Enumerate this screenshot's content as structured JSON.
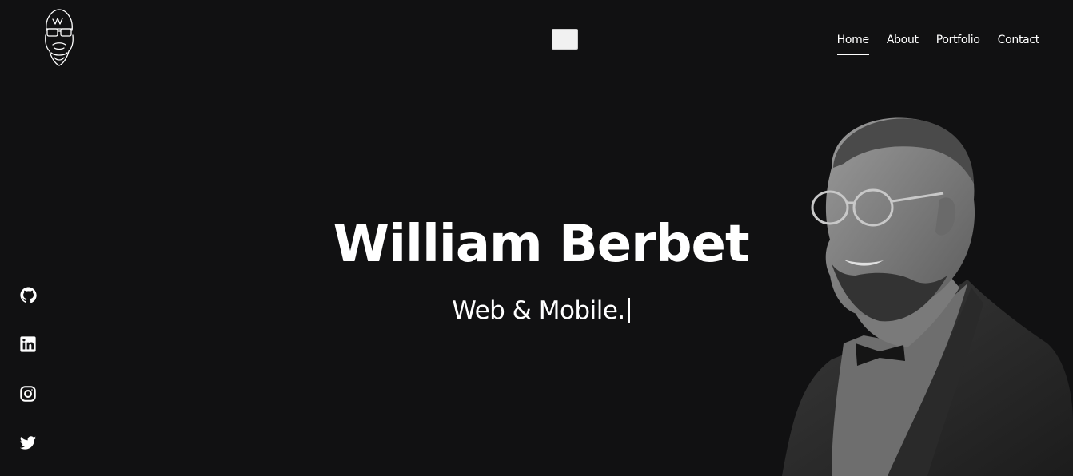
{
  "header": {
    "logo_icon": "bearded-man-logo-icon",
    "menu_toggle_icon": "menu-toggle-icon"
  },
  "nav": {
    "items": [
      {
        "label": "Home",
        "active": true
      },
      {
        "label": "About",
        "active": false
      },
      {
        "label": "Portfolio",
        "active": false
      },
      {
        "label": "Contact",
        "active": false
      }
    ]
  },
  "hero": {
    "name": "William Berbet",
    "tagline": "Web & Mobile."
  },
  "social": {
    "icons": [
      "github-icon",
      "linkedin-icon",
      "instagram-icon",
      "twitter-icon"
    ]
  },
  "colors": {
    "background": "#111112",
    "text": "#ffffff"
  }
}
